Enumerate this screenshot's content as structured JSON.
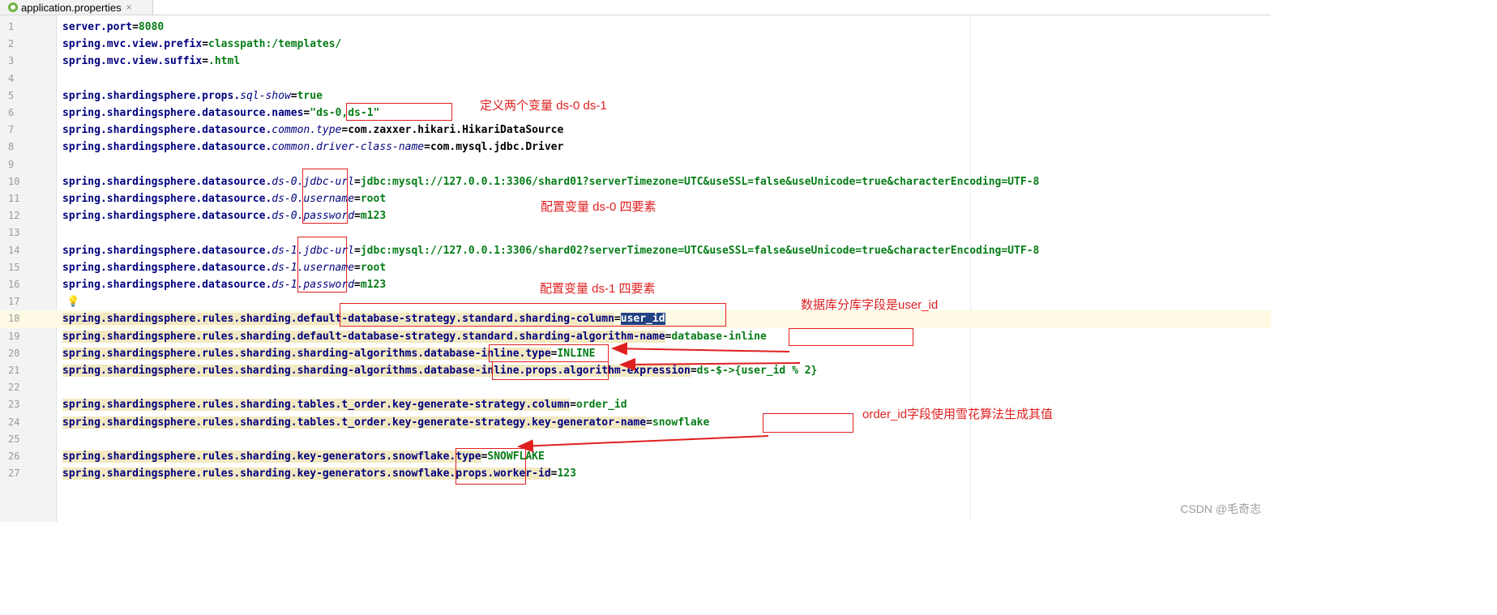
{
  "tab": {
    "filename": "application.properties",
    "close_glyph": "×",
    "icon": "spring-leaf-icon"
  },
  "lines": [
    {
      "n": "1",
      "segs": [
        [
          "k",
          "server.port"
        ],
        [
          "vb",
          "="
        ],
        [
          "v",
          "8080"
        ]
      ]
    },
    {
      "n": "2",
      "segs": [
        [
          "k",
          "spring.mvc.view.prefix"
        ],
        [
          "vb",
          "="
        ],
        [
          "v",
          "classpath:/templates/"
        ]
      ]
    },
    {
      "n": "3",
      "segs": [
        [
          "k",
          "spring.mvc.view.suffix"
        ],
        [
          "vb",
          "="
        ],
        [
          "v",
          ".html"
        ]
      ]
    },
    {
      "n": "4",
      "segs": []
    },
    {
      "n": "5",
      "segs": [
        [
          "k",
          "spring.shardingsphere.props."
        ],
        [
          "i",
          "sql-show"
        ],
        [
          "vb",
          "="
        ],
        [
          "v",
          "true"
        ]
      ]
    },
    {
      "n": "6",
      "segs": [
        [
          "k",
          "spring.shardingsphere.datasource.names"
        ],
        [
          "vb",
          "="
        ],
        [
          "v",
          "\"ds-0,ds-1\""
        ]
      ]
    },
    {
      "n": "7",
      "segs": [
        [
          "k",
          "spring.shardingsphere.datasource."
        ],
        [
          "i",
          "common.type"
        ],
        [
          "vb",
          "="
        ],
        [
          "vb",
          "com.zaxxer.hikari.HikariDataSource"
        ]
      ]
    },
    {
      "n": "8",
      "segs": [
        [
          "k",
          "spring.shardingsphere.datasource."
        ],
        [
          "i",
          "common.driver-class-name"
        ],
        [
          "vb",
          "="
        ],
        [
          "vb",
          "com.mysql.jdbc.Driver"
        ]
      ]
    },
    {
      "n": "9",
      "segs": []
    },
    {
      "n": "10",
      "segs": [
        [
          "k",
          "spring.shardingsphere.datasource."
        ],
        [
          "i",
          "ds-0.jdbc-url"
        ],
        [
          "vb",
          "="
        ],
        [
          "v",
          "jdbc:mysql://127.0.0.1:3306/shard01?serverTimezone=UTC&useSSL=false&useUnicode=true&characterEncoding=UTF-8"
        ]
      ]
    },
    {
      "n": "11",
      "segs": [
        [
          "k",
          "spring.shardingsphere.datasource."
        ],
        [
          "i",
          "ds-0.username"
        ],
        [
          "vb",
          "="
        ],
        [
          "v",
          "root"
        ]
      ]
    },
    {
      "n": "12",
      "segs": [
        [
          "k",
          "spring.shardingsphere.datasource."
        ],
        [
          "i",
          "ds-0.password"
        ],
        [
          "vb",
          "="
        ],
        [
          "v",
          "m123"
        ]
      ]
    },
    {
      "n": "13",
      "segs": []
    },
    {
      "n": "14",
      "segs": [
        [
          "k",
          "spring.shardingsphere.datasource."
        ],
        [
          "i",
          "ds-1.jdbc-url"
        ],
        [
          "vb",
          "="
        ],
        [
          "v",
          "jdbc:mysql://127.0.0.1:3306/shard02?serverTimezone=UTC&useSSL=false&useUnicode=true&characterEncoding=UTF-8"
        ]
      ]
    },
    {
      "n": "15",
      "segs": [
        [
          "k",
          "spring.shardingsphere.datasource."
        ],
        [
          "i",
          "ds-1.username"
        ],
        [
          "vb",
          "="
        ],
        [
          "v",
          "root"
        ]
      ]
    },
    {
      "n": "16",
      "segs": [
        [
          "k",
          "spring.shardingsphere.datasource."
        ],
        [
          "i",
          "ds-1.password"
        ],
        [
          "vb",
          "="
        ],
        [
          "v",
          "m123"
        ]
      ]
    },
    {
      "n": "17",
      "segs": []
    },
    {
      "n": "18",
      "segs": [
        [
          "k hl",
          "spring.shardingsphere.rules.sharding.default-database-strategy.standard.sharding-column"
        ],
        [
          "vb",
          "="
        ],
        [
          "v sel",
          "user_id"
        ]
      ]
    },
    {
      "n": "19",
      "segs": [
        [
          "k hl",
          "spring.shardingsphere.rules.sharding.default-database-strategy.standard.sharding-algorithm-name"
        ],
        [
          "vb",
          "="
        ],
        [
          "v",
          "database-inline"
        ]
      ]
    },
    {
      "n": "20",
      "segs": [
        [
          "k hl",
          "spring.shardingsphere.rules.sharding.sharding-algorithms.database-inline.type"
        ],
        [
          "vb",
          "="
        ],
        [
          "v",
          "INLINE"
        ]
      ]
    },
    {
      "n": "21",
      "segs": [
        [
          "k hl",
          "spring.shardingsphere.rules.sharding.sharding-algorithms.database-inline.props.algorithm-expression"
        ],
        [
          "vb",
          "="
        ],
        [
          "v",
          "ds-$->{user_id % 2}"
        ]
      ]
    },
    {
      "n": "22",
      "segs": []
    },
    {
      "n": "23",
      "segs": [
        [
          "k hl",
          "spring.shardingsphere.rules.sharding.tables.t_order.key-generate-strategy.column"
        ],
        [
          "vb",
          "="
        ],
        [
          "v",
          "order_id"
        ]
      ]
    },
    {
      "n": "24",
      "segs": [
        [
          "k hl",
          "spring.shardingsphere.rules.sharding.tables.t_order.key-generate-strategy.key-generator-name"
        ],
        [
          "vb",
          "="
        ],
        [
          "v",
          "snowflake"
        ]
      ]
    },
    {
      "n": "25",
      "segs": []
    },
    {
      "n": "26",
      "segs": [
        [
          "k hl",
          "spring.shardingsphere.rules.sharding.key-generators.snowflake.type"
        ],
        [
          "vb",
          "="
        ],
        [
          "v",
          "SNOWFLAKE"
        ]
      ]
    },
    {
      "n": "27",
      "segs": [
        [
          "k hl",
          "spring.shardingsphere.rules.sharding.key-generators.snowflake.props.worker-id"
        ],
        [
          "vb",
          "="
        ],
        [
          "v",
          "123"
        ]
      ]
    }
  ],
  "annotations": {
    "a1": "定义两个变量 ds-0 ds-1",
    "a2": "配置变量 ds-0  四要素",
    "a3": "配置变量 ds-1 四要素",
    "a4": "数据库分库字段是user_id",
    "a5": "order_id字段使用雪花算法生成其值"
  },
  "watermark": "CSDN @毛奇志",
  "colors": {
    "annotation_red": "#e02020",
    "key_navy": "#000080",
    "value_green": "#067d17",
    "selection": "#214283"
  }
}
